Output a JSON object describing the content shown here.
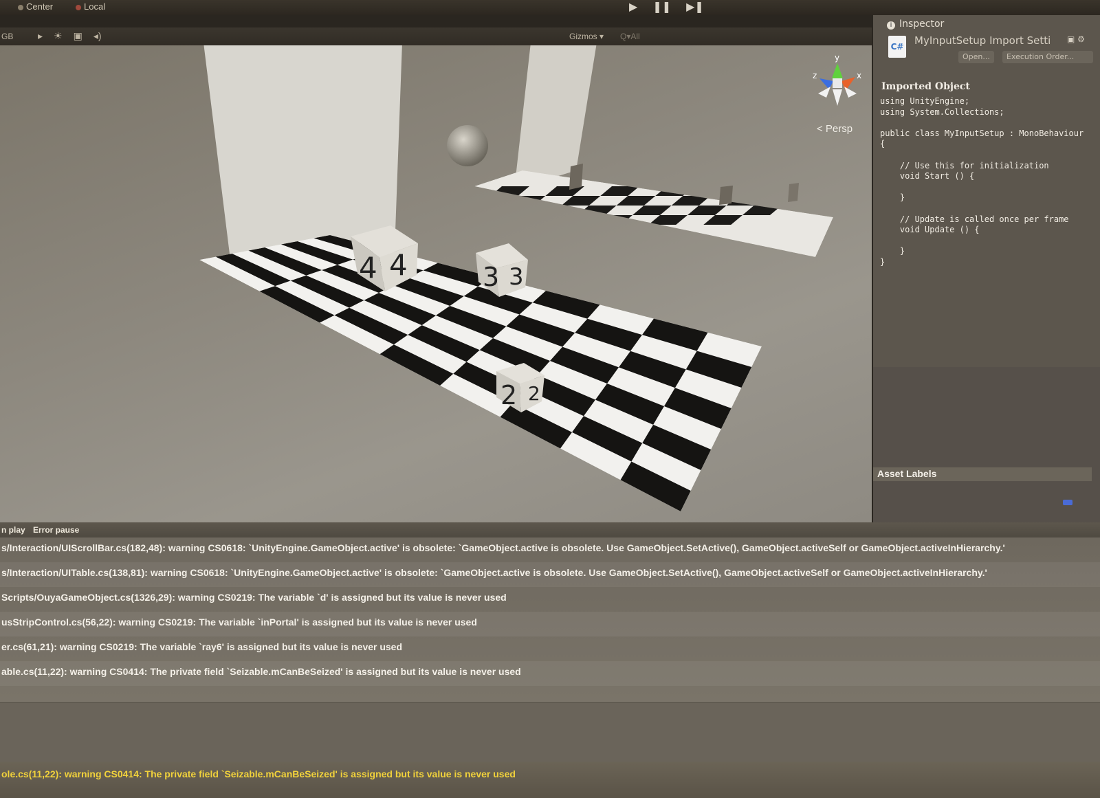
{
  "toolbar": {
    "pivot_center": "Center",
    "pivot_local": "Local",
    "play": "▶",
    "pause": "❚❚",
    "step": "▶❚"
  },
  "scene_toolbar": {
    "rgb_label": "GB",
    "gizmos_label": "Gizmos ▾",
    "search_placeholder": "Q▾All"
  },
  "scene": {
    "persp_label": "< Persp",
    "gizmo_axes": {
      "y": "y",
      "x": "x",
      "z": "z"
    },
    "cube_labels": [
      "4",
      "3",
      "2"
    ]
  },
  "inspector": {
    "tab_label": "Inspector",
    "asset_title": "MyInputSetup Import Setti",
    "open_button": "Open...",
    "execution_order_button": "Execution Order...",
    "section_title": "Imported Object",
    "code": "using UnityEngine;\nusing System.Collections;\n\npublic class MyInputSetup : MonoBehaviour\n{\n\n    // Use this for initialization\n    void Start () {\n\n    }\n\n    // Update is called once per frame\n    void Update () {\n\n    }\n}",
    "asset_labels": "Asset Labels"
  },
  "console": {
    "clear_on_play": "n play",
    "error_pause": "Error pause",
    "entries": [
      "s/Interaction/UIScrollBar.cs(182,48): warning CS0618: `UnityEngine.GameObject.active' is obsolete: `GameObject.active is obsolete. Use GameObject.SetActive(), GameObject.activeSelf or GameObject.activeInHierarchy.'",
      "s/Interaction/UITable.cs(138,81): warning CS0618: `UnityEngine.GameObject.active' is obsolete: `GameObject.active is obsolete. Use GameObject.SetActive(), GameObject.activeSelf or GameObject.activeInHierarchy.'",
      "Scripts/OuyaGameObject.cs(1326,29): warning CS0219: The variable `d' is assigned but its value is never used",
      "usStripControl.cs(56,22): warning CS0219: The variable `inPortal' is assigned but its value is never used",
      "er.cs(61,21): warning CS0219: The variable `ray6' is assigned but its value is never used",
      "able.cs(11,22): warning CS0414: The private field `Seizable.mCanBeSeized' is assigned but its value is never used"
    ],
    "status_message": "ole.cs(11,22): warning CS0414: The private field `Seizable.mCanBeSeized' is assigned but its value is never used"
  },
  "colors": {
    "status_text": "#f1d23b",
    "csharp_icon": "#3b76c4",
    "gizmo_y": "#5fd13c",
    "gizmo_x": "#e8622b",
    "gizmo_z": "#3a6de0"
  }
}
